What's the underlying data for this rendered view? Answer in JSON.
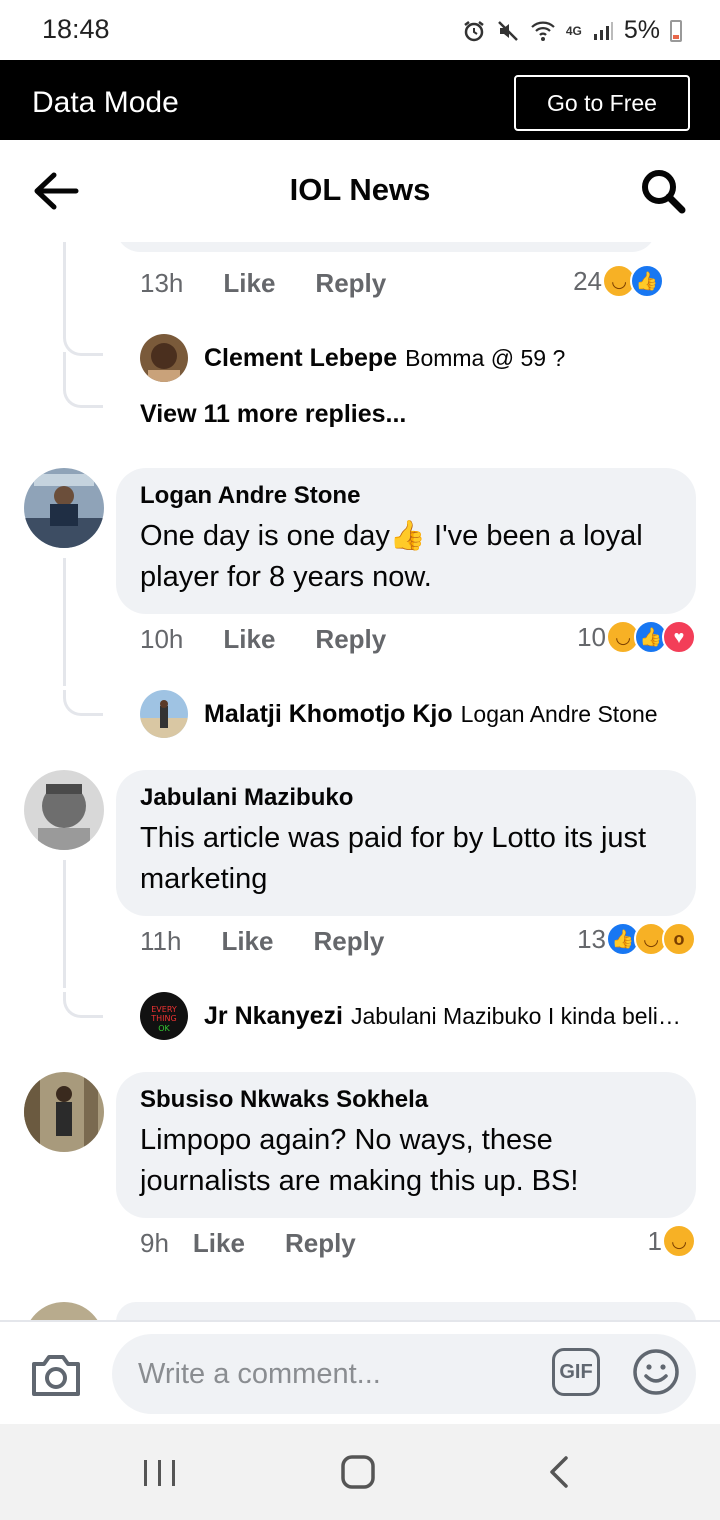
{
  "status_bar": {
    "time": "18:48",
    "network_label": "4G",
    "battery_percent": "5%"
  },
  "data_mode": {
    "title": "Data Mode",
    "go_free_label": "Go to Free"
  },
  "header": {
    "title": "IOL News",
    "back_icon": "arrow-left-icon",
    "search_icon": "search-icon"
  },
  "thread_top": {
    "time": "13h",
    "like_label": "Like",
    "reply_label": "Reply",
    "reaction_count": "24",
    "reactions": [
      "haha",
      "like"
    ],
    "reply": {
      "name": "Clement Lebepe",
      "text": "Bomma @ 59 ?"
    },
    "view_more": "View 11 more replies..."
  },
  "comments": [
    {
      "name": "Logan Andre Stone",
      "text_part1": "One day is one day",
      "emoji": "👍",
      "text_part2": " I've been a loyal player for 8 years now.",
      "time": "10h",
      "like_label": "Like",
      "reply_label": "Reply",
      "reaction_count": "10",
      "reactions": [
        "haha",
        "like",
        "love"
      ],
      "reply": {
        "name": "Malatji Khomotjo Kjo",
        "text": "Logan Andre Stone"
      }
    },
    {
      "name": "Jabulani Mazibuko",
      "text": "This article was paid for by Lotto its just marketing",
      "time": "11h",
      "like_label": "Like",
      "reply_label": "Reply",
      "reaction_count": "13",
      "reactions": [
        "like",
        "haha",
        "wow"
      ],
      "reply": {
        "name": "Jr Nkanyezi",
        "text": "Jabulani Mazibuko I kinda believe"
      }
    },
    {
      "name": "Sbusiso Nkwaks Sokhela",
      "text": "Limpopo again? No ways, these journalists are making this up. BS!",
      "time": "9h",
      "like_label": "Like",
      "reply_label": "Reply",
      "reaction_count": "1",
      "reactions": [
        "haha"
      ]
    }
  ],
  "composer": {
    "placeholder": "Write a comment...",
    "camera_icon": "camera-icon",
    "gif_label": "GIF",
    "emoji_icon": "smiley-icon"
  },
  "nav": {
    "recent_icon": "recent-apps-icon",
    "home_icon": "home-icon",
    "back_icon": "back-chevron-icon"
  },
  "colors": {
    "bubble": "#f0f2f5",
    "like_blue": "#1877f2",
    "love_red": "#f33e58",
    "haha_yellow": "#f7b125",
    "meta_gray": "#65676b"
  }
}
